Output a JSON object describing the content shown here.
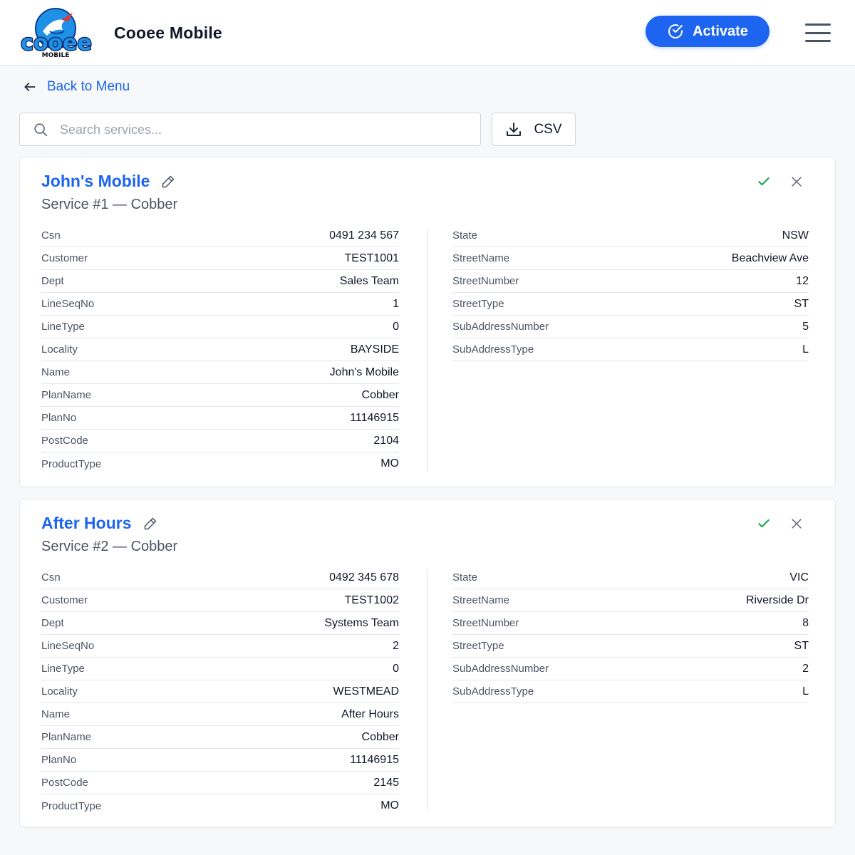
{
  "header": {
    "logo_text": "cooee",
    "logo_subtext": "MOBILE",
    "app_title": "Cooee Mobile",
    "activate_label": "Activate"
  },
  "nav": {
    "back_label": "Back to Menu"
  },
  "toolbar": {
    "search_placeholder": "Search services...",
    "csv_label": "CSV"
  },
  "colors": {
    "accent": "#1d64f0",
    "success": "#16a34a"
  },
  "services": [
    {
      "title": "John's Mobile",
      "subtitle": "Service #1 — Cobber",
      "left": [
        {
          "k": "Csn",
          "v": "0491 234 567"
        },
        {
          "k": "Customer",
          "v": "TEST1001"
        },
        {
          "k": "Dept",
          "v": "Sales Team"
        },
        {
          "k": "LineSeqNo",
          "v": "1"
        },
        {
          "k": "LineType",
          "v": "0"
        },
        {
          "k": "Locality",
          "v": "BAYSIDE"
        },
        {
          "k": "Name",
          "v": "John's Mobile"
        },
        {
          "k": "PlanName",
          "v": "Cobber"
        },
        {
          "k": "PlanNo",
          "v": "11146915"
        },
        {
          "k": "PostCode",
          "v": "2104"
        },
        {
          "k": "ProductType",
          "v": "MO"
        }
      ],
      "right": [
        {
          "k": "State",
          "v": "NSW"
        },
        {
          "k": "StreetName",
          "v": "Beachview Ave"
        },
        {
          "k": "StreetNumber",
          "v": "12"
        },
        {
          "k": "StreetType",
          "v": "ST"
        },
        {
          "k": "SubAddressNumber",
          "v": "5"
        },
        {
          "k": "SubAddressType",
          "v": "L"
        }
      ]
    },
    {
      "title": "After Hours",
      "subtitle": "Service #2 — Cobber",
      "left": [
        {
          "k": "Csn",
          "v": "0492 345 678"
        },
        {
          "k": "Customer",
          "v": "TEST1002"
        },
        {
          "k": "Dept",
          "v": "Systems Team"
        },
        {
          "k": "LineSeqNo",
          "v": "2"
        },
        {
          "k": "LineType",
          "v": "0"
        },
        {
          "k": "Locality",
          "v": "WESTMEAD"
        },
        {
          "k": "Name",
          "v": "After Hours"
        },
        {
          "k": "PlanName",
          "v": "Cobber"
        },
        {
          "k": "PlanNo",
          "v": "11146915"
        },
        {
          "k": "PostCode",
          "v": "2145"
        },
        {
          "k": "ProductType",
          "v": "MO"
        }
      ],
      "right": [
        {
          "k": "State",
          "v": "VIC"
        },
        {
          "k": "StreetName",
          "v": "Riverside Dr"
        },
        {
          "k": "StreetNumber",
          "v": "8"
        },
        {
          "k": "StreetType",
          "v": "ST"
        },
        {
          "k": "SubAddressNumber",
          "v": "2"
        },
        {
          "k": "SubAddressType",
          "v": "L"
        }
      ]
    }
  ]
}
